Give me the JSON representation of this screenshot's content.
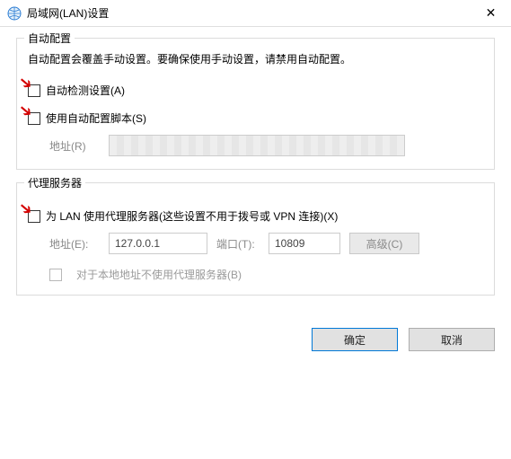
{
  "window": {
    "title": "局域网(LAN)设置",
    "close_glyph": "✕"
  },
  "auto": {
    "legend": "自动配置",
    "desc": "自动配置会覆盖手动设置。要确保使用手动设置，请禁用自动配置。",
    "detect_label": "自动检测设置(A)",
    "script_label": "使用自动配置脚本(S)",
    "address_label": "地址(R)",
    "address_value": ""
  },
  "proxy": {
    "legend": "代理服务器",
    "use_label": "为 LAN 使用代理服务器(这些设置不用于拨号或 VPN 连接)(X)",
    "address_label": "地址(E):",
    "address_value": "127.0.0.1",
    "port_label": "端口(T):",
    "port_value": "10809",
    "advanced_label": "高级(C)",
    "bypass_label": "对于本地地址不使用代理服务器(B)"
  },
  "buttons": {
    "ok": "确定",
    "cancel": "取消"
  }
}
